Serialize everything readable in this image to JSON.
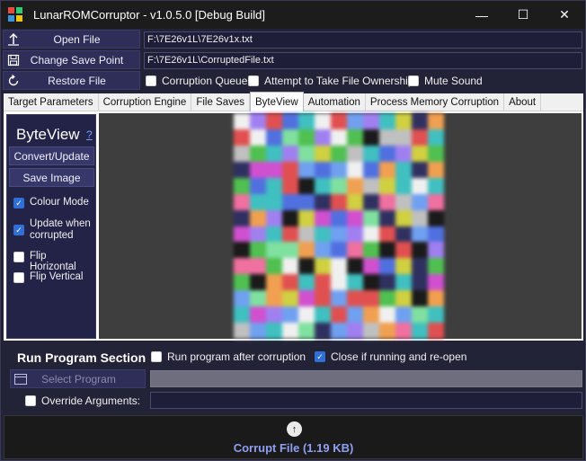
{
  "window": {
    "title": "LunarROMCorruptor - v1.0.5.0 [Debug Build]",
    "controls": [
      "—",
      "☐",
      "✕"
    ],
    "icon_colors": [
      "#e74c3c",
      "#2ecc71",
      "#3498db",
      "#f1c40f"
    ]
  },
  "file_section": {
    "open_file_label": "Open File",
    "change_save_point_label": "Change Save Point",
    "restore_file_label": "Restore File",
    "open_file_path": "F:\\7E26v1L\\7E26v1x.txt",
    "save_point_path": "F:\\7E26v1L\\CorruptedFile.txt",
    "options": [
      {
        "label": "Corruption Queue",
        "checked": false
      },
      {
        "label": "Attempt to Take File Ownership",
        "checked": false
      },
      {
        "label": "Mute Sound",
        "checked": false
      }
    ]
  },
  "tabs": [
    {
      "label": "Target Parameters",
      "active": false
    },
    {
      "label": "Corruption Engine",
      "active": false
    },
    {
      "label": "File Saves",
      "active": false
    },
    {
      "label": "ByteView",
      "active": true
    },
    {
      "label": "Automation",
      "active": false
    },
    {
      "label": "Process Memory Corruption",
      "active": false
    },
    {
      "label": "About",
      "active": false
    }
  ],
  "byteview": {
    "title": "ByteView",
    "help": "?",
    "convert_label": "Convert/Update",
    "save_image_label": "Save Image",
    "options": [
      {
        "label": "Colour Mode",
        "checked": true
      },
      {
        "label": "Update when corrupted",
        "checked": true
      },
      {
        "label": "Flip Horizontal",
        "checked": false
      },
      {
        "label": "Flip Vertical",
        "checked": false
      }
    ]
  },
  "run_program": {
    "title": "Run Program Section",
    "run_after_label": "Run program after corruption",
    "run_after_checked": false,
    "close_reopen_label": "Close if running and re-open",
    "close_reopen_checked": true,
    "select_program_label": "Select Program",
    "override_args_label": "Override Arguments:",
    "override_args_checked": false,
    "program_path": "",
    "arguments": ""
  },
  "corrupt": {
    "label": "Corrupt File (1.19 KB)"
  },
  "colors": {
    "accent": "#2f6fd6",
    "corrupt_text": "#8fa0f0"
  }
}
